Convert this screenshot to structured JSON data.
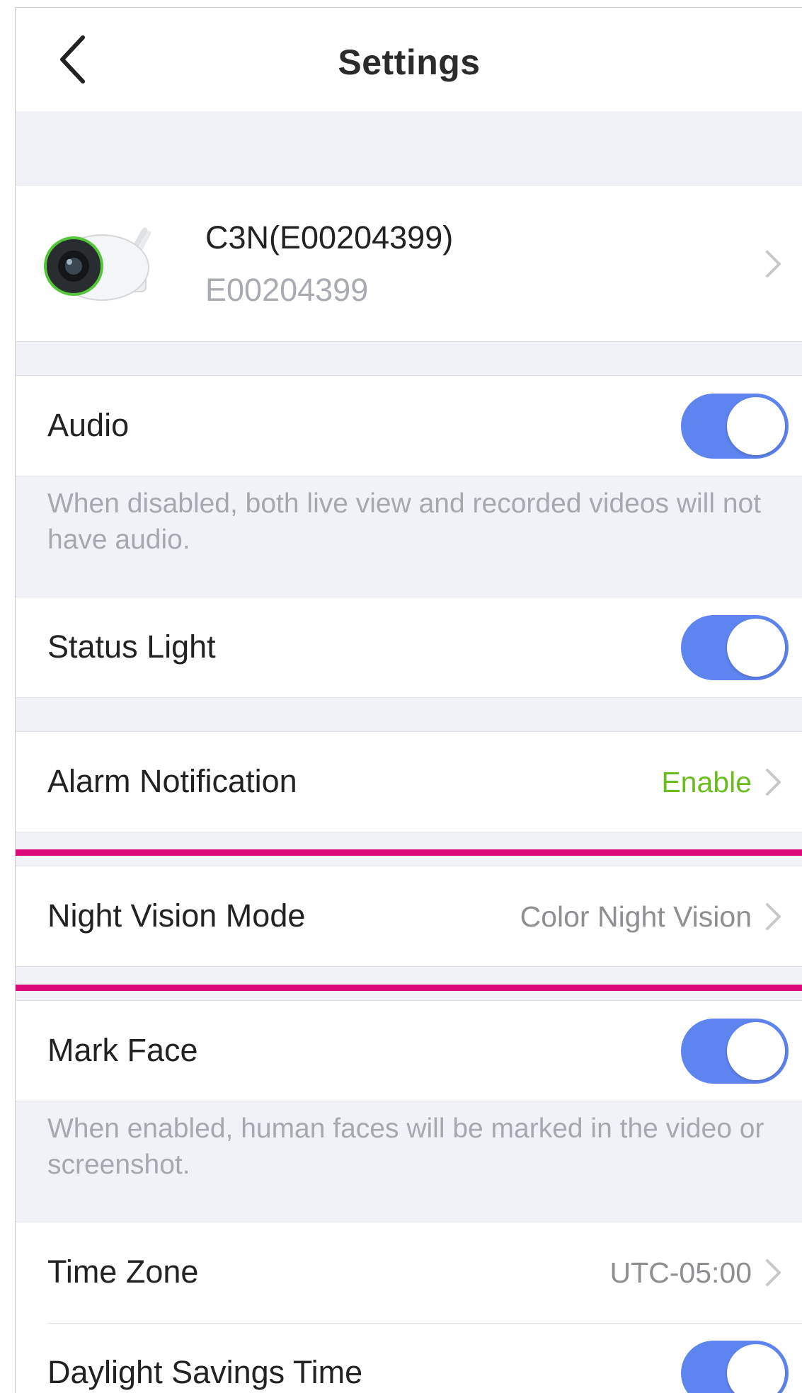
{
  "header": {
    "title": "Settings",
    "back_icon": "chevron-left-icon"
  },
  "device": {
    "name": "C3N(E00204399)",
    "serial": "E00204399",
    "image": "security-camera-icon"
  },
  "settings": {
    "audio": {
      "label": "Audio",
      "enabled": true,
      "hint": "When disabled, both live view and recorded videos will not have audio."
    },
    "status_light": {
      "label": "Status Light",
      "enabled": true
    },
    "alarm_notification": {
      "label": "Alarm Notification",
      "value": "Enable"
    },
    "night_vision": {
      "label": "Night Vision Mode",
      "value": "Color Night Vision"
    },
    "mark_face": {
      "label": "Mark Face",
      "enabled": true,
      "hint": "When enabled, human faces will be marked in the video or screenshot."
    },
    "time_zone": {
      "label": "Time Zone",
      "value": "UTC-05:00"
    },
    "daylight_savings": {
      "label": "Daylight Savings Time",
      "enabled": true
    }
  },
  "colors": {
    "toggle_on": "#5e84f0",
    "enable_green": "#6bbd1f",
    "highlight": "#de0a7b",
    "background": "#f1f2f7"
  }
}
